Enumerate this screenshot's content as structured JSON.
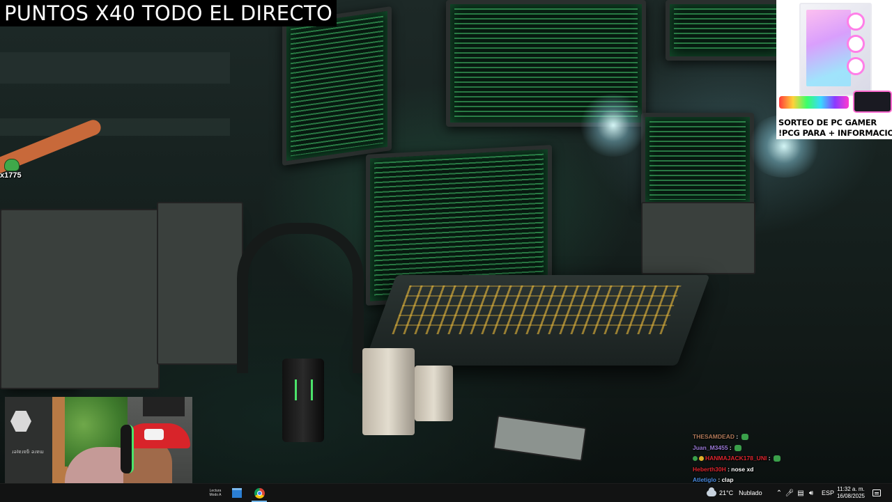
{
  "overlay": {
    "title": "PUNTOS X40 TODO EL DIRECTO",
    "viewer_count": "x1775",
    "ad": {
      "line1": "SORTEO DE PC GAMER",
      "line2": "!PCG PARA + INFORMACION"
    },
    "webcam_caption": "ɹǝʇɐɹɐƃ ǝɹɐɯ"
  },
  "chat": {
    "messages": [
      {
        "user": "THESAMDEAD",
        "text": "",
        "color": "#b07a5a",
        "emote": true
      },
      {
        "user": "Juan_M3455",
        "text": "",
        "color": "#9b7bd8",
        "emote": true
      },
      {
        "user": "HANMAJACK178_UNI",
        "text": "",
        "color": "#e0262f",
        "emote": true,
        "badges": [
          "#3aa04a",
          "#e0b028"
        ]
      },
      {
        "user": "Heberth30H",
        "text": "nose xd",
        "color": "#e0262f",
        "emote": false
      },
      {
        "user": "Atletiglo",
        "text": "clap",
        "color": "#4a8be0",
        "emote": false
      }
    ]
  },
  "taskbar": {
    "apps": [
      {
        "name": "taskbar-app-lectura",
        "label": "Lectura\nModo A"
      },
      {
        "name": "taskbar-app-explorer",
        "label": ""
      },
      {
        "name": "taskbar-app-chrome",
        "label": ""
      }
    ],
    "weather": {
      "temp": "21°C",
      "condition": "Nublado"
    },
    "tray_icons": [
      "chevron-up-icon",
      "microphone-icon",
      "network-icon",
      "battery-icon",
      "volume-icon"
    ],
    "language": "ESP",
    "time": "11:32 a. m.",
    "date": "16/08/2025",
    "colors": {
      "taskbar_bg": "#121313",
      "accent": "#76b9ed"
    }
  }
}
